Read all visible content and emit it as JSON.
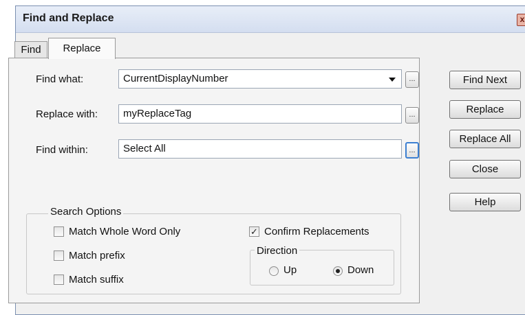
{
  "window": {
    "title": "Find and Replace",
    "close_glyph": "x"
  },
  "tabs": [
    {
      "label": "Find",
      "active": false
    },
    {
      "label": "Replace",
      "active": true
    }
  ],
  "form": {
    "find_what": {
      "label": "Find what:",
      "value": "CurrentDisplayNumber"
    },
    "replace_with": {
      "label": "Replace with:",
      "value": "myReplaceTag"
    },
    "find_within": {
      "label": "Find within:",
      "value": "Select All"
    },
    "browse_label": "..."
  },
  "buttons": {
    "find_next": "Find Next",
    "replace": "Replace",
    "replace_all": "Replace All",
    "close": "Close",
    "help": "Help"
  },
  "search_options": {
    "title": "Search Options",
    "match_whole_word": {
      "label": "Match Whole Word Only",
      "checked": false
    },
    "match_prefix": {
      "label": "Match prefix",
      "checked": false
    },
    "match_suffix": {
      "label": "Match suffix",
      "checked": false
    },
    "confirm_replacements": {
      "label": "Confirm Replacements",
      "checked": true,
      "mark": "✓"
    },
    "direction": {
      "title": "Direction",
      "up": {
        "label": "Up",
        "selected": false
      },
      "down": {
        "label": "Down",
        "selected": true
      }
    }
  }
}
